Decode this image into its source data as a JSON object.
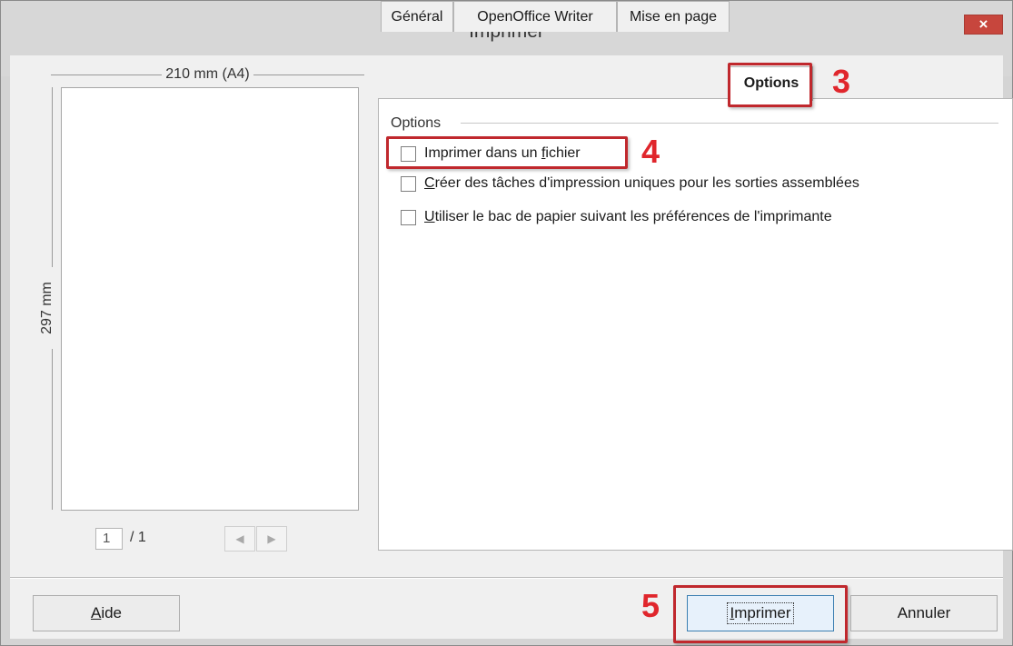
{
  "window": {
    "title": "Imprimer",
    "close_glyph": "×"
  },
  "preview": {
    "width_label": "210 mm (A4)",
    "height_label": "297 mm",
    "page_current": "1",
    "page_total": "/ 1",
    "prev_glyph": "◀",
    "next_glyph": "▶"
  },
  "tabs": [
    {
      "label": "Général"
    },
    {
      "label": "OpenOffice Writer"
    },
    {
      "label": "Mise en page"
    },
    {
      "label": "Options"
    }
  ],
  "options": {
    "group_label": "Options",
    "items": [
      {
        "prefix": "Imprimer dans un ",
        "mnemonic": "f",
        "suffix": "ichier",
        "checked": false
      },
      {
        "prefix": "",
        "mnemonic": "C",
        "suffix": "réer des tâches d'impression uniques pour les sorties assemblées",
        "checked": false
      },
      {
        "prefix": "",
        "mnemonic": "U",
        "suffix": "tiliser le bac de papier suivant les préférences de l'imprimante",
        "checked": false
      }
    ]
  },
  "annotations": {
    "step3": "3",
    "step4": "4",
    "step5": "5",
    "color": "#e0262c"
  },
  "buttons": {
    "help_mnemonic": "A",
    "help_rest": "ide",
    "print_mnemonic": "I",
    "print_rest": "mprimer",
    "cancel_label": "Annuler"
  }
}
